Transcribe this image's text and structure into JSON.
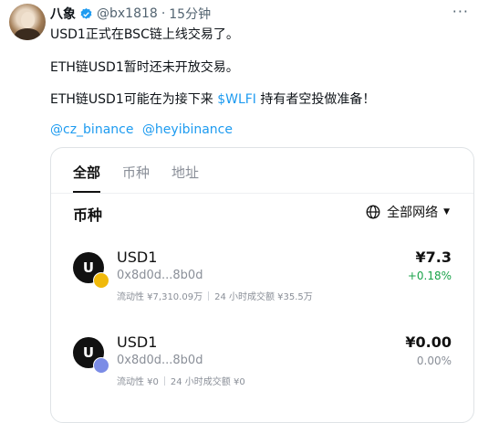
{
  "author": {
    "name": "八象",
    "handle": "@bx1818",
    "separator": "·",
    "time": "15分钟"
  },
  "tweet": {
    "line1": "USD1正式在BSC链上线交易了。",
    "line2": "ETH链USD1暂时还未开放交易。",
    "line3_prefix": "ETH链USD1可能在为接下来 ",
    "line3_link": "$WLFI",
    "line3_suffix": " 持有者空投做准备！",
    "mentions": [
      "@cz_binance",
      "@heyibinance"
    ]
  },
  "card": {
    "tabs": [
      {
        "label": "全部",
        "active": true
      },
      {
        "label": "币种",
        "active": false
      },
      {
        "label": "地址",
        "active": false
      }
    ],
    "section_title": "币种",
    "network_label": "全部网络",
    "coins": [
      {
        "logo_letter": "U",
        "chain": "BSC",
        "name": "USD1",
        "address": "0x8d0d...8b0d",
        "liquidity": "流动性 ¥7,310.09万",
        "volume": "24 小时成交额 ¥35.5万",
        "price": "¥7.3",
        "change": "+0.18%",
        "change_color": "#1aa34a"
      },
      {
        "logo_letter": "U",
        "chain": "ETH",
        "name": "USD1",
        "address": "0x8d0d...8b0d",
        "liquidity": "流动性 ¥0",
        "volume": "24 小时成交额 ¥0",
        "price": "¥0.00",
        "change": "0.00%",
        "change_color": "#8a8f98"
      }
    ]
  },
  "colors": {
    "link": "#1d9bf0",
    "verified": "#1d9bf0"
  }
}
